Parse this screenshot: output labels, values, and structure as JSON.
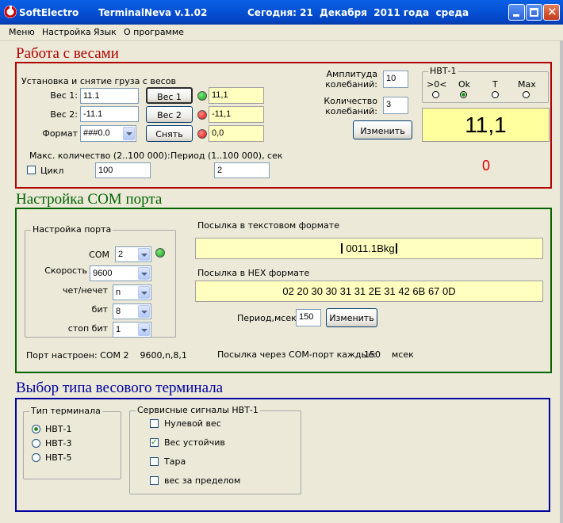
{
  "window": {
    "brand": "SoftElectro",
    "title": "TerminalNeva v.1.02",
    "date_text": "Сегодня: 21  Декабря  2011 года  среда"
  },
  "menu": [
    "Меню",
    "Настройка",
    "Язык",
    "О программе"
  ],
  "colors": {
    "red_section": "#b00000",
    "green_section": "#006400",
    "blue_section": "#0000a0",
    "display_bg": "#ffff9e"
  },
  "weights": {
    "title": "Работа с весами",
    "group_caption": "Установка и снятие груза с весов",
    "w1_label": "Вес 1:",
    "w1_value": "11.1",
    "w1_button": "Вес 1",
    "w1_display": "11,1",
    "w2_label": "Вес 2:",
    "w2_value": "-11.1",
    "w2_button": "Вес 2",
    "w2_display": "-11,1",
    "format_label": "Формат",
    "format_value": "###0.0",
    "remove_button": "Снять",
    "remove_display": "0,0",
    "max_label": "Макс. количество (2..100 000):",
    "max_value": "100",
    "cycle_label": "Цикл",
    "period_label": "Период (1..100 000), сек",
    "period_value": "2",
    "amp_label_1": "Амплитуда",
    "amp_label_2": "колебаний:",
    "amp_value": "10",
    "cnt_label_1": "Количество",
    "cnt_label_2": "колебаний:",
    "cnt_value": "3",
    "change_button": "Изменить",
    "hbt_caption": "НВТ-1",
    "ind_labels": [
      ">0<",
      "Ok",
      "T",
      "Max"
    ],
    "big_display": "11,1",
    "counter": "0"
  },
  "com": {
    "title": "Настройка COM порта",
    "port_caption": "Настройка порта",
    "com_label": "COM",
    "com_value": "2",
    "speed_label": "Скорость",
    "speed_value": "9600",
    "parity_label": "чет/нечет",
    "parity_value": "n",
    "bits_label": "бит",
    "bits_value": "8",
    "stop_label": "стоп бит",
    "stop_value": "1",
    "status_text": "Порт настроен: COM 2    9600,n,8,1",
    "text_label": "Посылка в текстовом формате",
    "text_value": "0011.1Bkg",
    "hex_label": "Посылка в HEX формате",
    "hex_value": "02 20 30 30 31 31 2E 31 42 6B 67 0D",
    "period_label": "Период,мсек:",
    "period_value": "150",
    "change_button": "Изменить",
    "every_text": "Посылка через COM-порт каждые:",
    "every_value": "150",
    "every_unit": "мсек"
  },
  "terminal": {
    "title": "Выбор типа весового терминала",
    "type_caption": "Тип терминала",
    "types": [
      "НВТ-1",
      "НВТ-3",
      "НВТ-5"
    ],
    "signals_caption": "Сервисные сигналы НВТ-1",
    "signals": [
      "Нулевой вес",
      "Вес устойчив",
      "Тара",
      "вес за пределом"
    ]
  }
}
